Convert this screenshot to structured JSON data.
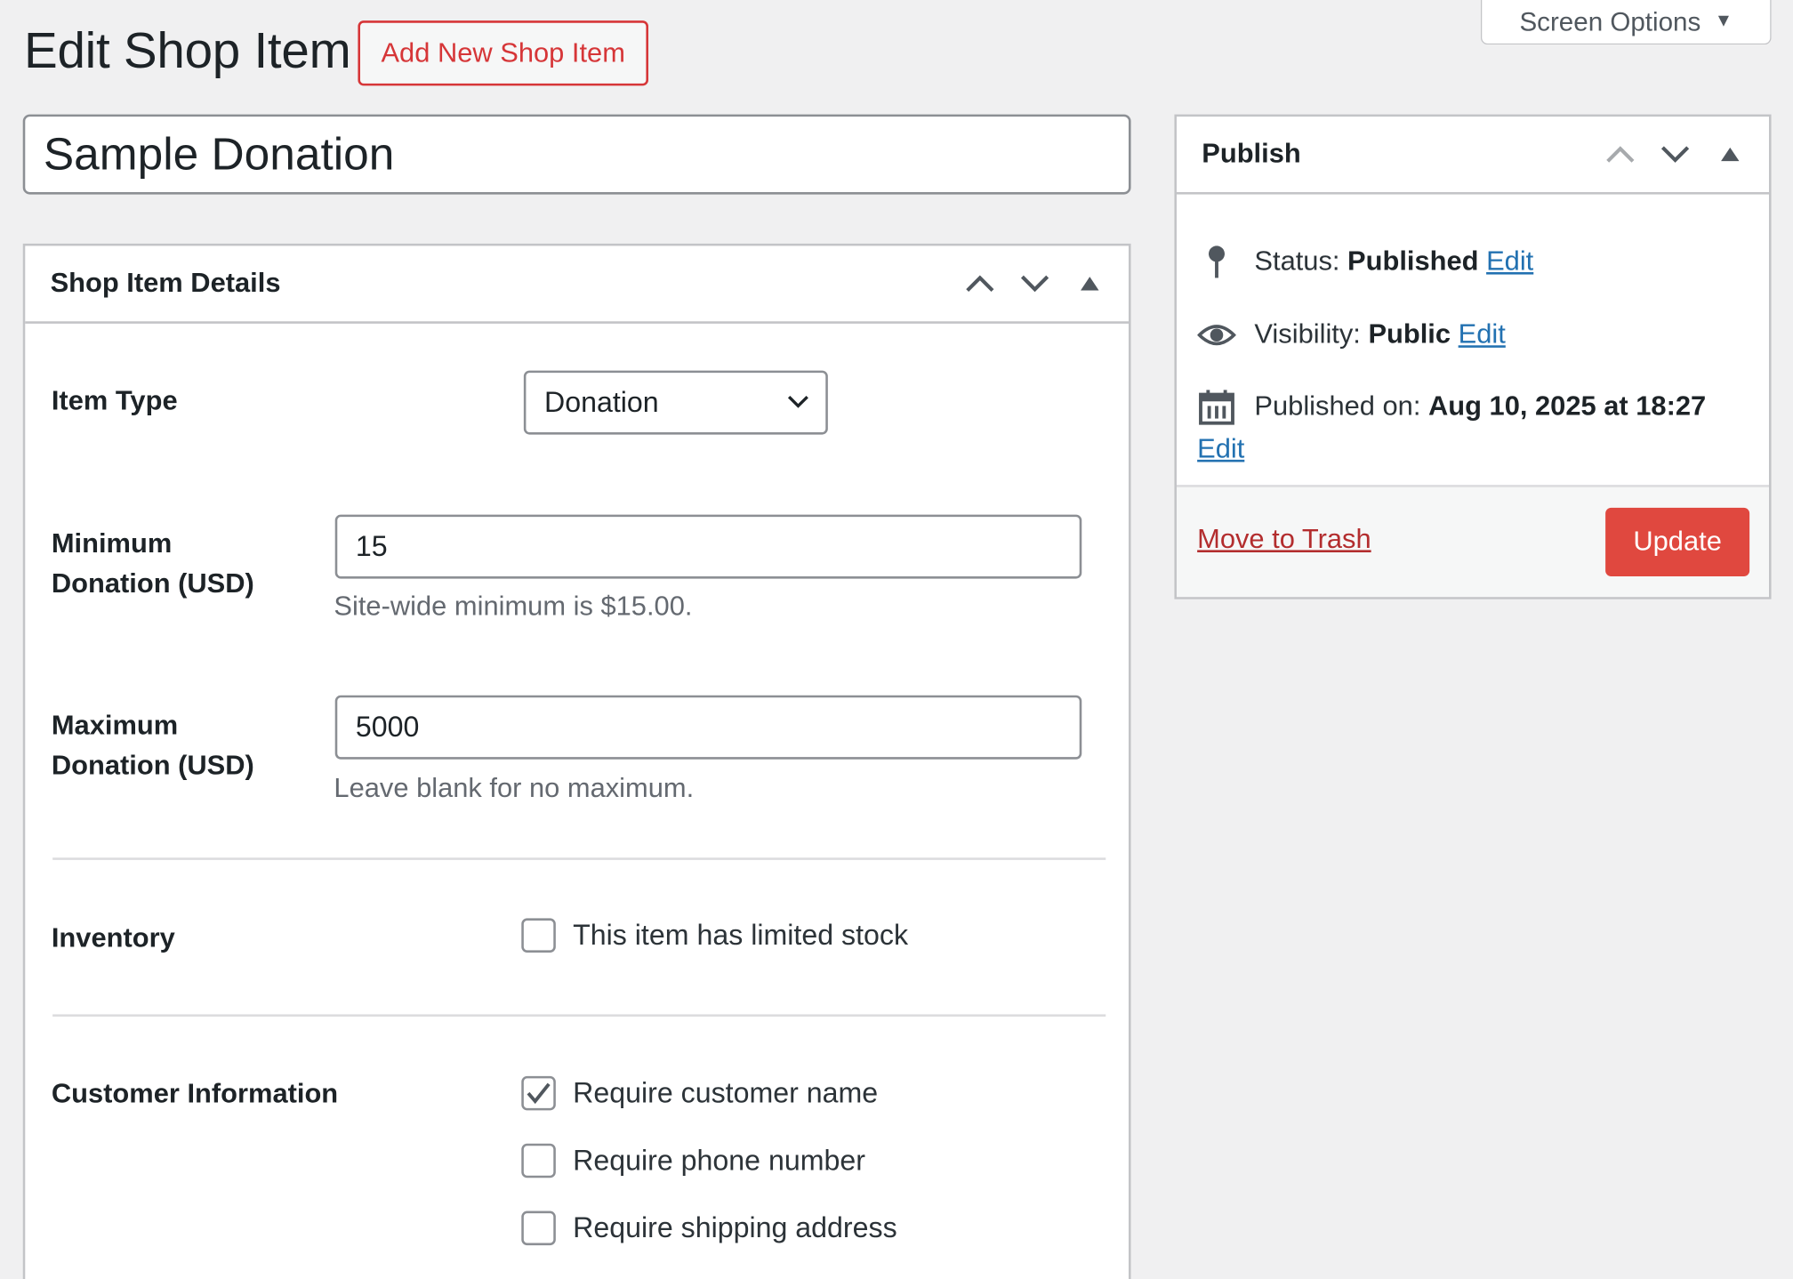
{
  "header": {
    "screen_options_label": "Screen Options",
    "page_title": "Edit Shop Item",
    "add_new_label": "Add New Shop Item"
  },
  "post_title": "Sample Donation",
  "details": {
    "box_title": "Shop Item Details",
    "item_type": {
      "label": "Item Type",
      "selected": "Donation"
    },
    "minimum": {
      "label_line1": "Minimum",
      "label_line2": "Donation (USD)",
      "value": "15",
      "description": "Site-wide minimum is $15.00."
    },
    "maximum": {
      "label_line1": "Maximum",
      "label_line2": "Donation (USD)",
      "value": "5000",
      "description": "Leave blank for no maximum."
    },
    "inventory": {
      "label": "Inventory",
      "option": "This item has limited stock",
      "checked": false
    },
    "customer": {
      "label": "Customer Information",
      "options": [
        {
          "label": "Require customer name",
          "checked": true
        },
        {
          "label": "Require phone number",
          "checked": false
        },
        {
          "label": "Require shipping address",
          "checked": false
        }
      ]
    }
  },
  "publish": {
    "box_title": "Publish",
    "status_prefix": "Status:",
    "status_value": "Published",
    "visibility_prefix": "Visibility:",
    "visibility_value": "Public",
    "published_prefix": "Published on:",
    "published_value": "Aug 10, 2025 at 18:27",
    "edit_label": "Edit",
    "trash_label": "Move to Trash",
    "update_label": "Update"
  },
  "colors": {
    "accent_red": "#d63638",
    "update_button": "#e0483f",
    "link_blue": "#2271b1",
    "trash_red": "#b32d2e",
    "background": "#f0f0f1"
  },
  "icons": [
    "caret-down-icon",
    "chevron-up-icon",
    "chevron-down-icon",
    "triangle-up-icon",
    "pin-icon",
    "eye-icon",
    "calendar-icon",
    "checkmark-icon"
  ]
}
